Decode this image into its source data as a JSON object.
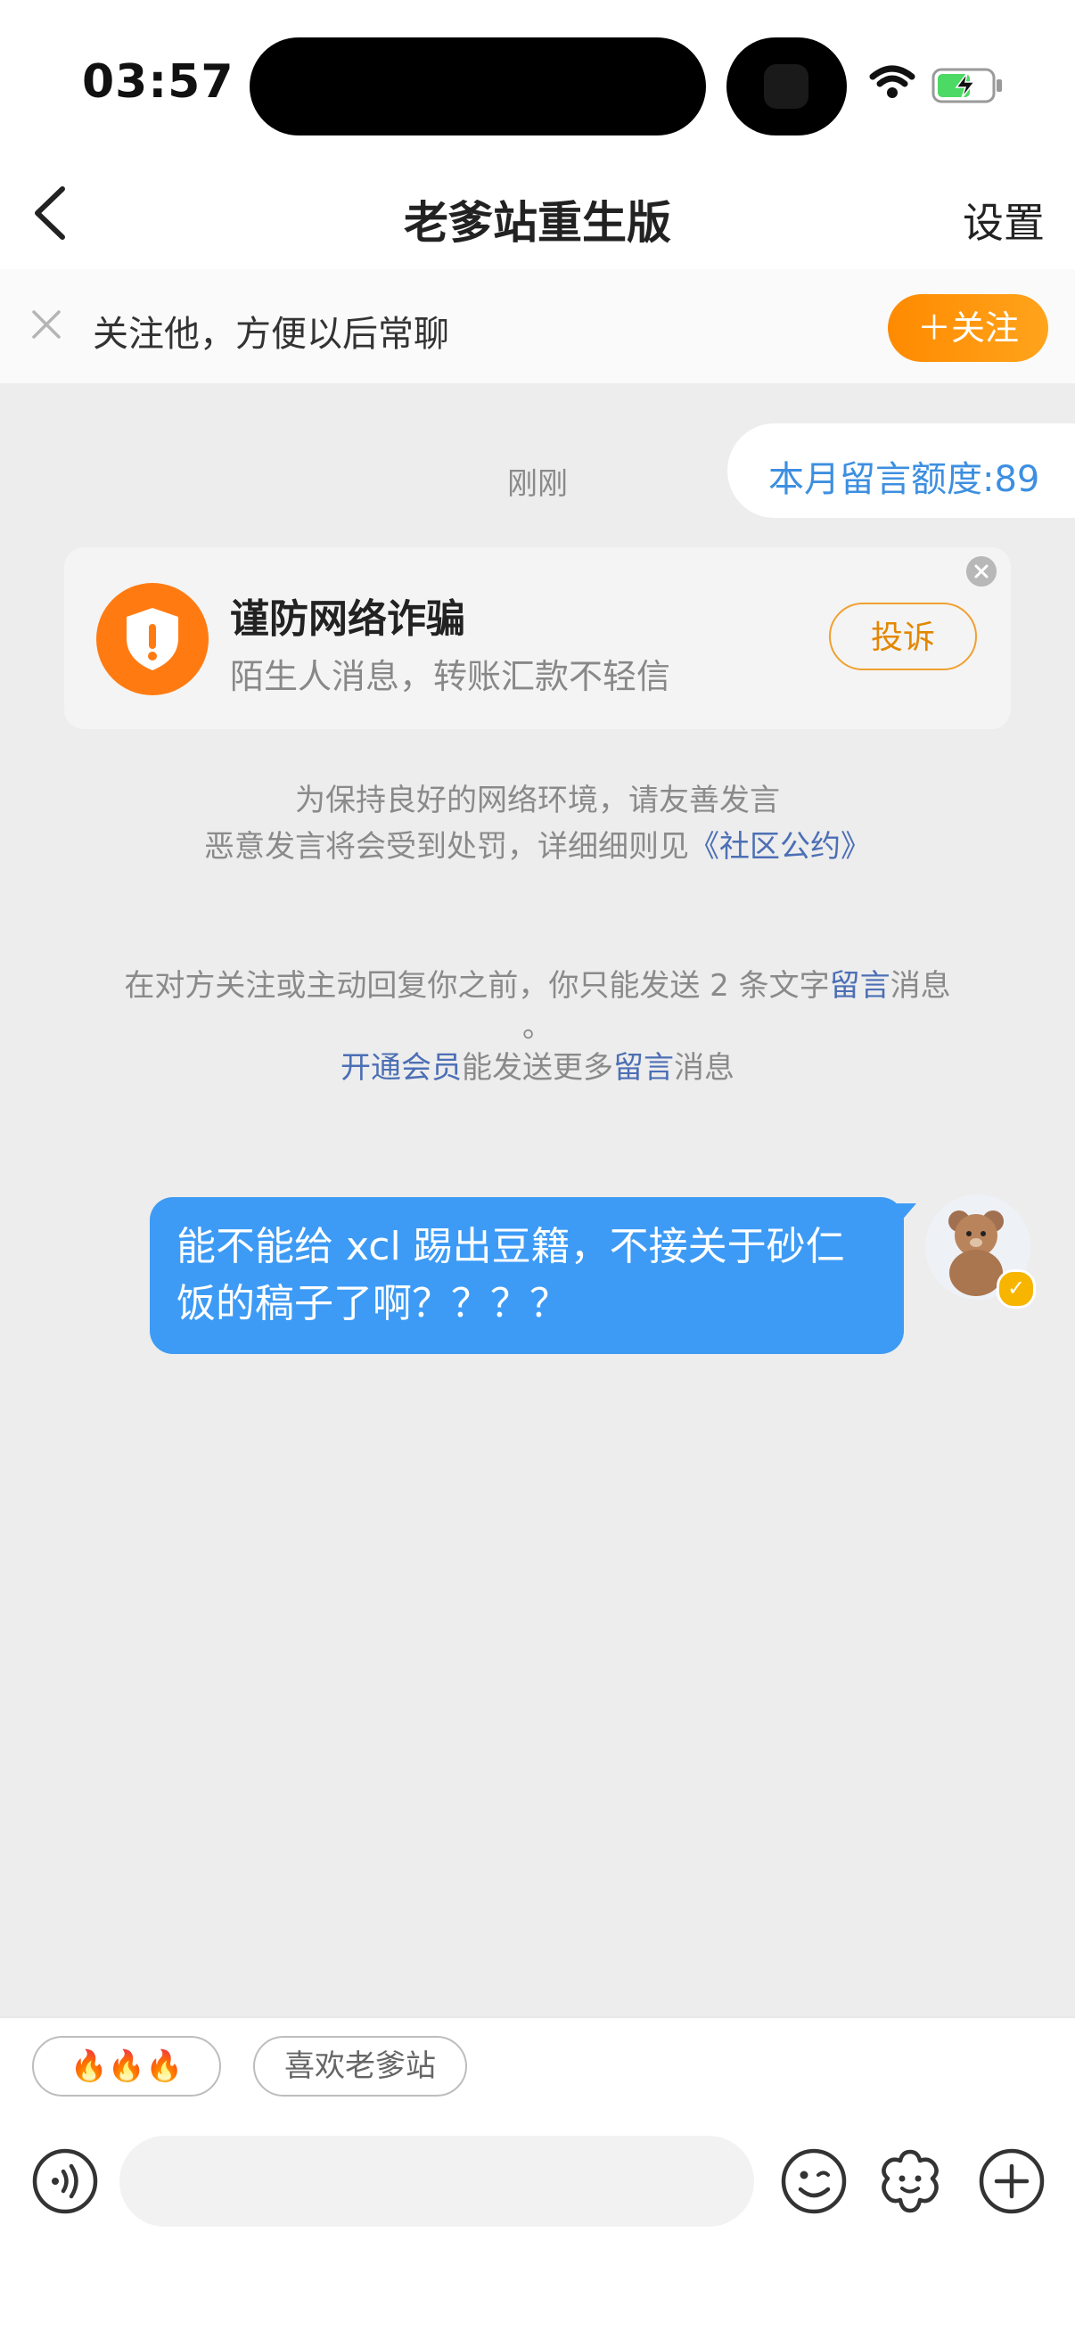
{
  "status_bar": {
    "time": "03:57"
  },
  "header": {
    "title": "老爹站重生版",
    "settings_label": "设置"
  },
  "follow_bar": {
    "text": "关注他，方便以后常聊",
    "follow_button": "＋关注"
  },
  "chat": {
    "timestamp": "刚刚",
    "quota_label": "本月留言额度:89",
    "warning_card": {
      "title": "谨防网络诈骗",
      "subtitle": "陌生人消息，转账汇款不轻信",
      "report_button": "投诉"
    },
    "notice1": {
      "line1": "为保持良好的网络环境，请友善发言",
      "line2_prefix": "恶意发言将会受到处罚，详细细则见",
      "line2_link": "《社区公约》"
    },
    "notice2": {
      "line1_prefix": "在对方关注或主动回复你之前，你只能发送 2 条文字",
      "line1_link": "留言",
      "line1_suffix": "消息",
      "line1_wrap": "。",
      "line2_link1": "开通会员",
      "line2_mid": "能发送更多",
      "line2_link2": "留言",
      "line2_suffix": "消息"
    },
    "messages": [
      {
        "text": "能不能给 xcl 踢出豆籍，不接关于砂仁饭的稿子了啊？？？？",
        "sender": "me"
      }
    ]
  },
  "quick_replies": [
    "🔥🔥🔥",
    "喜欢老爹站"
  ],
  "input_bar": {
    "placeholder": "",
    "icons": [
      "voice-icon",
      "emoji-icon",
      "sticker-icon",
      "plus-icon"
    ]
  },
  "colors": {
    "accent_orange": "#ff8a00",
    "bubble_blue": "#3d9bf5",
    "link_blue": "#4c6fb5"
  }
}
